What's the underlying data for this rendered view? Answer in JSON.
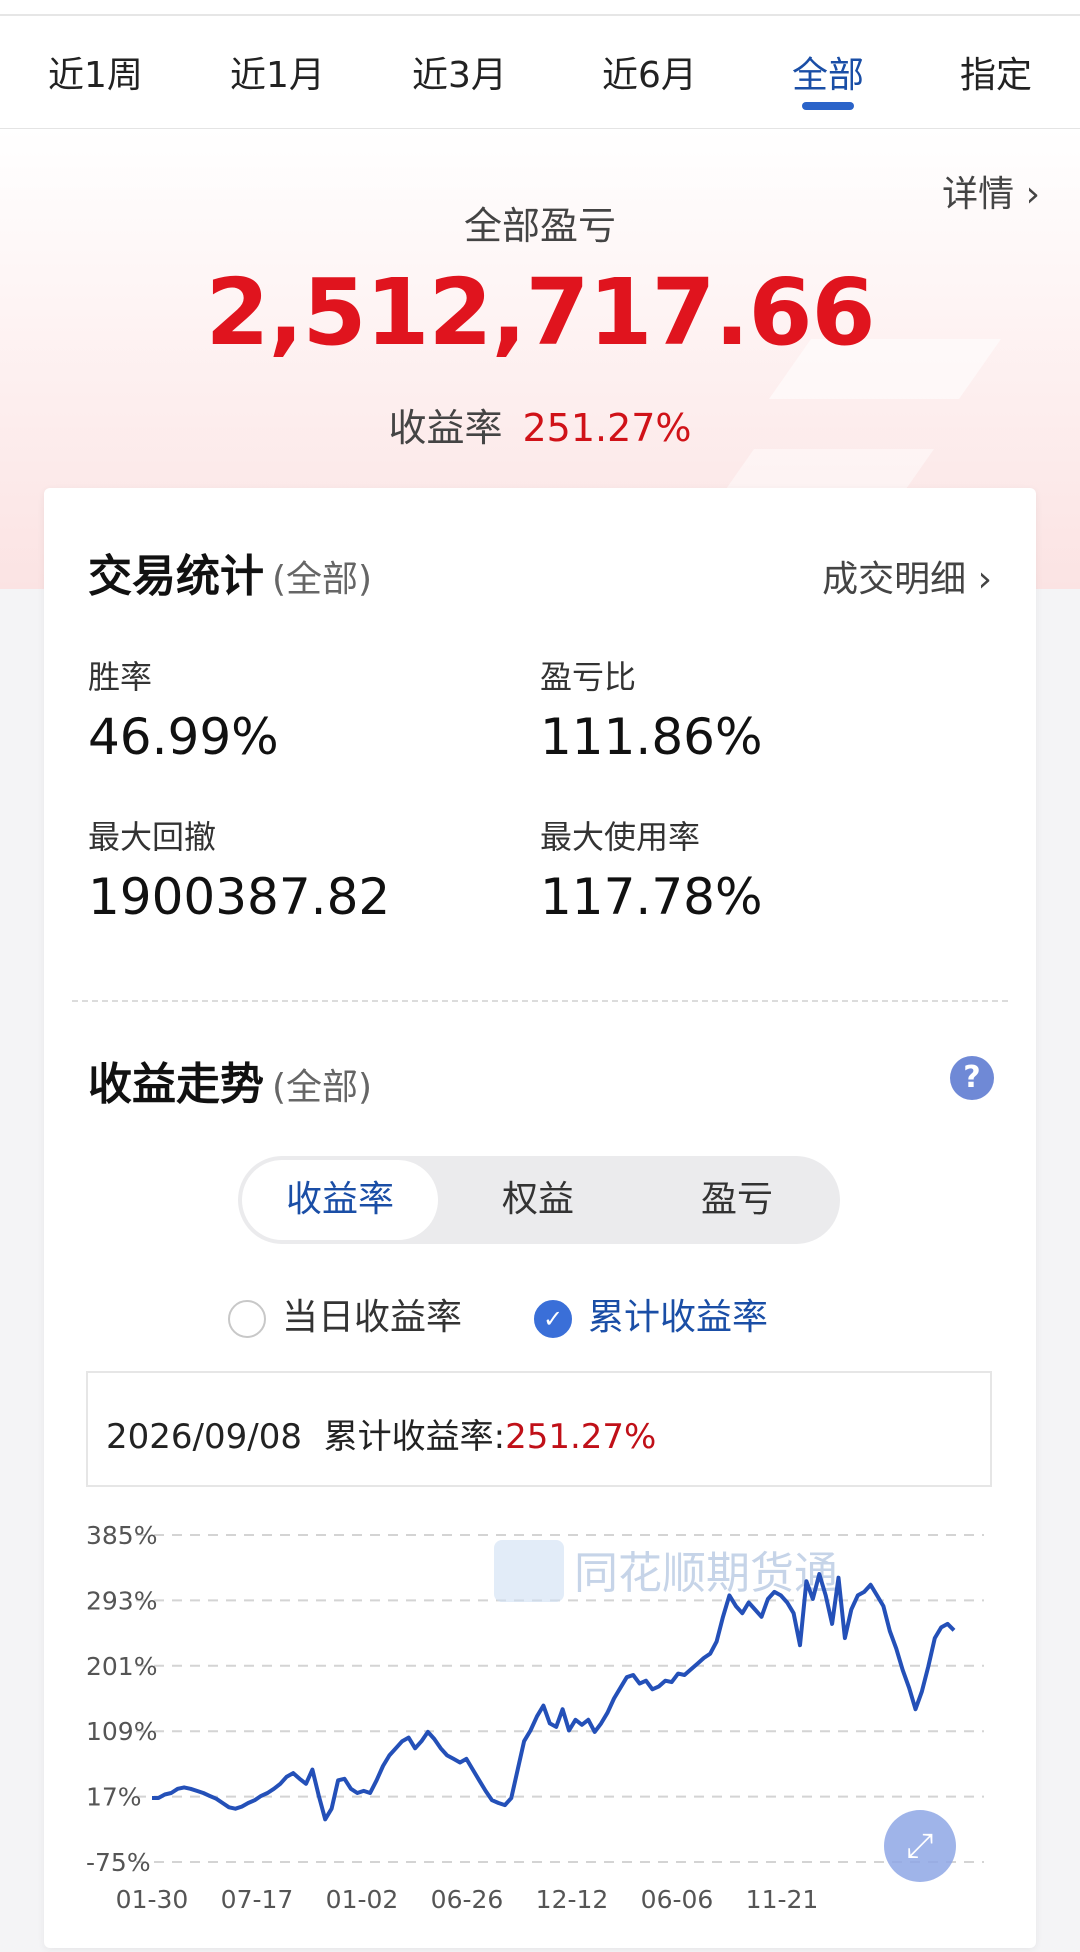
{
  "tabs": [
    {
      "label": "近1周"
    },
    {
      "label": "近1月"
    },
    {
      "label": "近3月"
    },
    {
      "label": "近6月"
    },
    {
      "label": "全部",
      "active": true
    },
    {
      "label": "指定"
    }
  ],
  "summary": {
    "detail_link": "详情 ›",
    "title": "全部盈亏",
    "value": "2,512,717.66",
    "rate_label": "收益率",
    "rate_value": "251.27%"
  },
  "trade_stats": {
    "title": "交易统计",
    "scope": "(全部)",
    "detail_link": "成交明细 ›",
    "items": [
      {
        "label": "胜率",
        "value": "46.99%"
      },
      {
        "label": "盈亏比",
        "value": "111.86%"
      },
      {
        "label": "最大回撤",
        "value": "1900387.82"
      },
      {
        "label": "最大使用率",
        "value": "117.78%"
      }
    ]
  },
  "trend": {
    "title": "收益走势",
    "scope": "(全部)",
    "help": "?",
    "segments": [
      {
        "label": "收益率",
        "active": true
      },
      {
        "label": "权益"
      },
      {
        "label": "盈亏"
      }
    ],
    "radios": [
      {
        "label": "当日收益率",
        "checked": false
      },
      {
        "label": "累计收益率",
        "checked": true
      }
    ],
    "info_date": "2026/09/08",
    "info_label": "累计收益率:",
    "info_value": "251.27%",
    "expand_icon": "expand-icon"
  },
  "watermark": "同花顺期货通",
  "colors": {
    "accent": "#2a63c9",
    "loss_red": "#e0141e",
    "line": "#2450b8"
  },
  "chart_data": {
    "type": "line",
    "title": "",
    "xlabel": "",
    "ylabel": "",
    "y_ticks": [
      "385%",
      "293%",
      "201%",
      "109%",
      "17%",
      "-75%"
    ],
    "ylim": [
      -75,
      385
    ],
    "x_ticks": [
      "01-30",
      "07-17",
      "01-02",
      "06-26",
      "12-12",
      "06-06",
      "11-21"
    ],
    "grid": true,
    "series": [
      {
        "values": [
          15,
          15,
          20,
          22,
          28,
          30,
          28,
          25,
          22,
          18,
          14,
          8,
          2,
          0,
          3,
          8,
          12,
          18,
          22,
          28,
          35,
          45,
          50,
          42,
          35,
          55,
          18,
          -15,
          0,
          40,
          42,
          28,
          22,
          25,
          22,
          40,
          60,
          75,
          85,
          95,
          100,
          85,
          95,
          108,
          98,
          85,
          75,
          70,
          65,
          70,
          55,
          40,
          25,
          12,
          8,
          5,
          15,
          55,
          95,
          110,
          130,
          145,
          120,
          115,
          140,
          110,
          125,
          118,
          125,
          108,
          120,
          135,
          155,
          170,
          185,
          188,
          176,
          180,
          168,
          172,
          180,
          178,
          190,
          188,
          196,
          204,
          212,
          218,
          235,
          270,
          300,
          285,
          275,
          290,
          280,
          270,
          295,
          305,
          300,
          290,
          275,
          230,
          320,
          295,
          330,
          300,
          260,
          325,
          240,
          280,
          300,
          305,
          315,
          300,
          285,
          250,
          225,
          195,
          170,
          140,
          165,
          200,
          240,
          255,
          260,
          251
        ]
      }
    ]
  }
}
